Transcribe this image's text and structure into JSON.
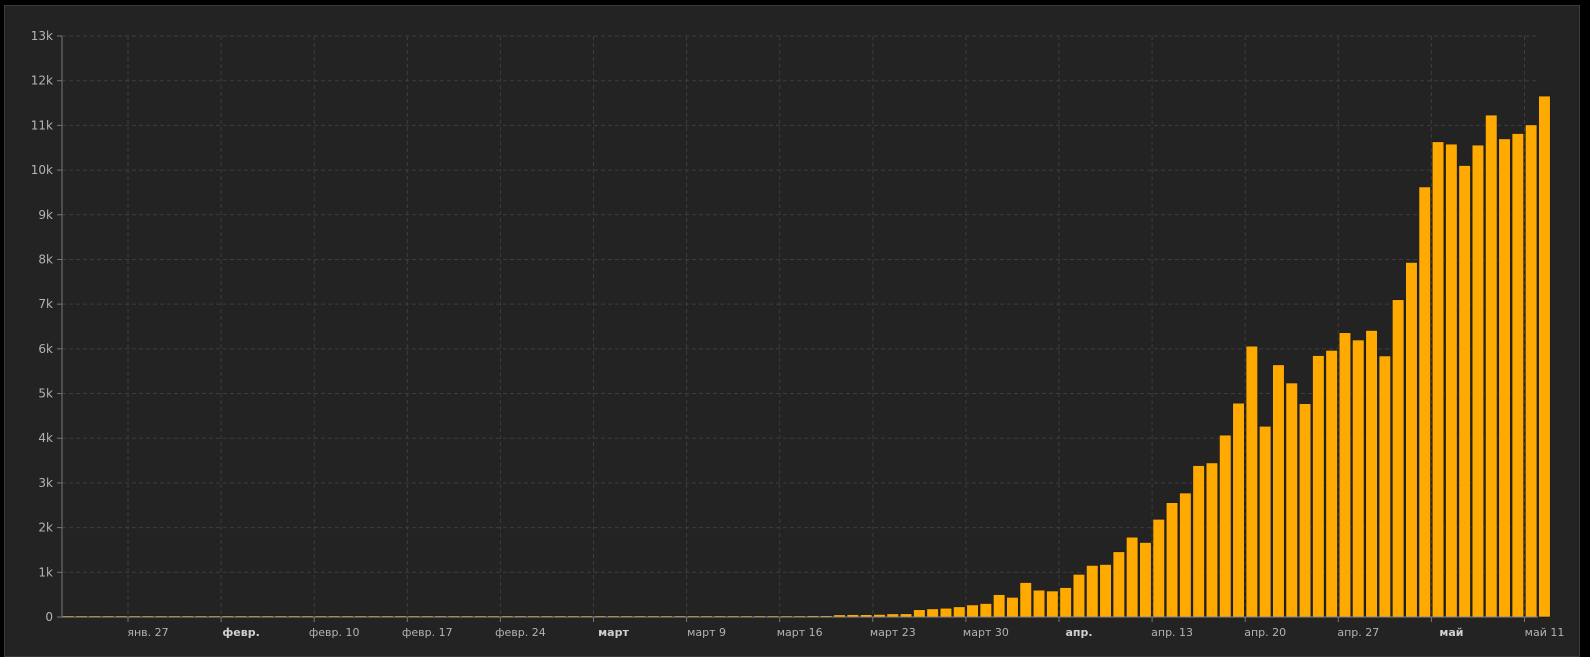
{
  "chart_data": {
    "type": "bar",
    "bar_color": "#FFAA00",
    "background": "#232323",
    "grid": true,
    "title": "",
    "xlabel": "",
    "ylabel": "",
    "ylim": [
      0,
      13000
    ],
    "yticks": [
      {
        "value": 0,
        "label": "0"
      },
      {
        "value": 1000,
        "label": "1k"
      },
      {
        "value": 2000,
        "label": "2k"
      },
      {
        "value": 3000,
        "label": "3k"
      },
      {
        "value": 4000,
        "label": "4k"
      },
      {
        "value": 5000,
        "label": "5k"
      },
      {
        "value": 6000,
        "label": "6k"
      },
      {
        "value": 7000,
        "label": "7k"
      },
      {
        "value": 8000,
        "label": "8k"
      },
      {
        "value": 9000,
        "label": "9k"
      },
      {
        "value": 10000,
        "label": "10k"
      },
      {
        "value": 11000,
        "label": "11k"
      },
      {
        "value": 12000,
        "label": "12k"
      },
      {
        "value": 13000,
        "label": "13k"
      }
    ],
    "xticks": [
      {
        "index": 5,
        "label": "янв. 27",
        "bold": false
      },
      {
        "index": 12,
        "label": "февр.",
        "bold": true
      },
      {
        "index": 19,
        "label": "февр. 10",
        "bold": false
      },
      {
        "index": 26,
        "label": "февр. 17",
        "bold": false
      },
      {
        "index": 33,
        "label": "февр. 24",
        "bold": false
      },
      {
        "index": 40,
        "label": "март",
        "bold": true
      },
      {
        "index": 47,
        "label": "март 9",
        "bold": false
      },
      {
        "index": 54,
        "label": "март 16",
        "bold": false
      },
      {
        "index": 61,
        "label": "март 23",
        "bold": false
      },
      {
        "index": 68,
        "label": "март 30",
        "bold": false
      },
      {
        "index": 75,
        "label": "апр.",
        "bold": true
      },
      {
        "index": 82,
        "label": "апр. 13",
        "bold": false
      },
      {
        "index": 89,
        "label": "апр. 20",
        "bold": false
      },
      {
        "index": 96,
        "label": "апр. 27",
        "bold": false
      },
      {
        "index": 103,
        "label": "май",
        "bold": true
      },
      {
        "index": 110,
        "label": "май 11",
        "bold": false
      }
    ],
    "x_start": "2020-01-22",
    "x_end": "2020-05-11",
    "values": [
      0,
      0,
      0,
      0,
      0,
      0,
      0,
      0,
      0,
      0,
      2,
      0,
      0,
      0,
      0,
      0,
      0,
      0,
      0,
      0,
      0,
      0,
      0,
      0,
      0,
      0,
      0,
      0,
      0,
      0,
      0,
      0,
      0,
      0,
      0,
      0,
      0,
      0,
      1,
      0,
      0,
      0,
      0,
      0,
      0,
      0,
      0,
      0,
      0,
      0,
      3,
      13,
      14,
      4,
      1,
      26,
      30,
      30,
      49,
      53,
      52,
      57,
      71,
      72,
      163,
      182,
      196,
      228,
      270,
      302,
      501,
      440,
      771,
      601,
      582,
      658,
      954,
      1154,
      1175,
      1459,
      1786,
      1667,
      2186,
      2558,
      2774,
      3388,
      3448,
      4070,
      4785,
      6060,
      4268,
      5642,
      5236,
      4774,
      5849,
      5966,
      6361,
      6198,
      6411,
      5841,
      7099,
      7933,
      9623,
      10633,
      10581,
      10102,
      10559,
      11231,
      10699,
      10817,
      11012,
      11656
    ]
  }
}
